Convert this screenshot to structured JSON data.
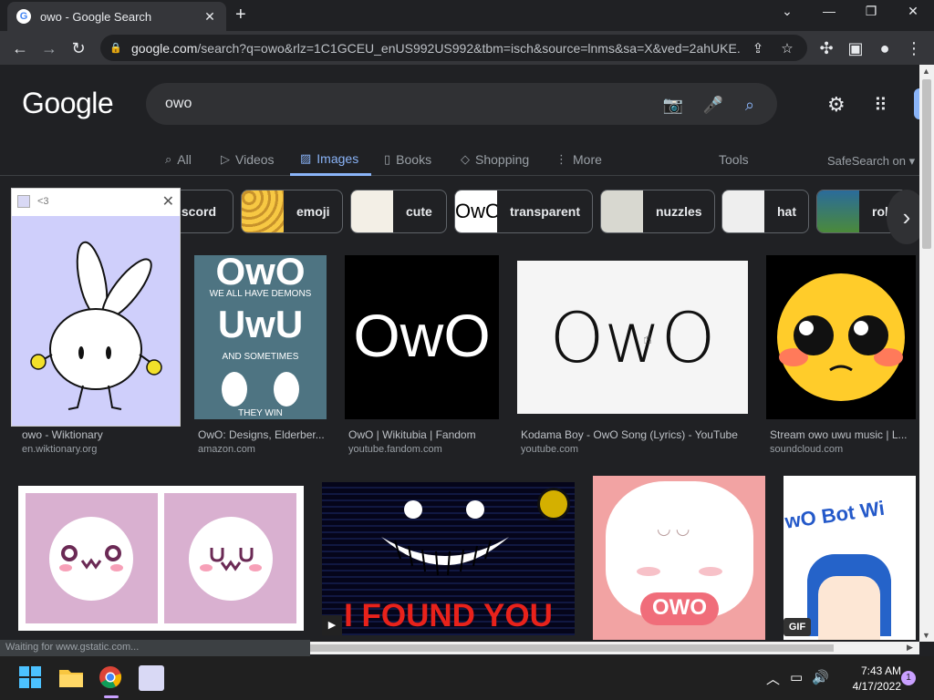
{
  "browser": {
    "tab_title": "owo - Google Search",
    "url_host": "google.com",
    "url_rest": "/search?q=owo&rlz=1C1GCEU_enUS992US992&tbm=isch&source=lnms&sa=X&ved=2ahUKE..."
  },
  "google": {
    "logo": "Google",
    "query": "owo",
    "nav": [
      "All",
      "Videos",
      "Images",
      "Books",
      "Shopping",
      "More"
    ],
    "tools": "Tools",
    "safesearch": "SafeSearch on"
  },
  "chips": [
    "iscord",
    "emoji",
    "cute",
    "transparent",
    "nuzzles",
    "hat",
    "rob"
  ],
  "popup": {
    "title": "<3"
  },
  "results_row1": [
    {
      "title": "owo - Wiktionary",
      "source": "en.wiktionary.org"
    },
    {
      "title": "OwO: Designs, Elderber...",
      "source": "amazon.com"
    },
    {
      "title": "OwO | Wikitubia | Fandom",
      "source": "youtube.fandom.com"
    },
    {
      "title": "Kodama Boy - OwO Song (Lyrics) - YouTube",
      "source": "youtube.com"
    },
    {
      "title": "Stream owo uwu music | L...",
      "source": "soundcloud.com"
    }
  ],
  "image_text": {
    "demons_1": "OwO",
    "demons_2": "WE ALL HAVE DEMONS",
    "demons_3": "UwU",
    "demons_4": "AND SOMETIMES",
    "demons_5": "THEY WIN",
    "wikitubia": "OwO",
    "kodama": "OwO",
    "found_you": "I FOUND YOU",
    "owo_bot": "wO Bot Wi",
    "discord_owo": "OWO",
    "gif": "GIF"
  },
  "status": "Waiting for www.gstatic.com...",
  "clock": {
    "time": "7:43 AM",
    "date": "4/17/2022"
  },
  "notifications": "1"
}
